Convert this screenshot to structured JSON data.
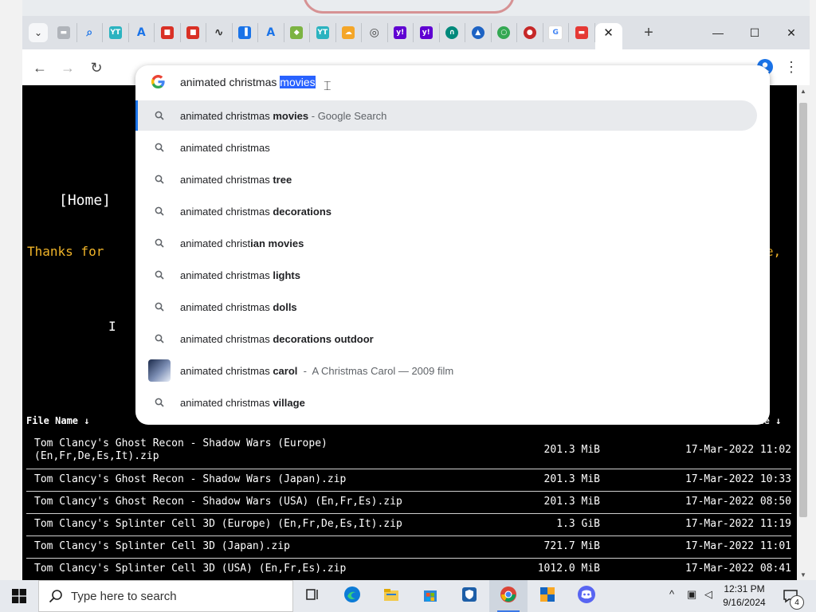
{
  "browser": {
    "tabs": [
      {
        "icon": "document-icon",
        "glyph": "▬",
        "color": "#b0b4ba"
      },
      {
        "icon": "search-icon",
        "glyph": "⌕",
        "color": "#1a73e8"
      },
      {
        "icon": "ytb-icon",
        "glyph": "YT",
        "color": "#2bb3c0"
      },
      {
        "icon": "a-logo-icon",
        "glyph": "A",
        "color": "#1a73e8"
      },
      {
        "icon": "bookmark-red-icon",
        "glyph": "■",
        "color": "#d93025"
      },
      {
        "icon": "bookmark-red-icon",
        "glyph": "■",
        "color": "#d93025"
      },
      {
        "icon": "chart-line-icon",
        "glyph": "∿",
        "color": "#333333"
      },
      {
        "icon": "bar-chart-icon",
        "glyph": "▐",
        "color": "#1a73e8"
      },
      {
        "icon": "a-logo-icon",
        "glyph": "A",
        "color": "#1a73e8"
      },
      {
        "icon": "diamond-icon",
        "glyph": "◆",
        "color": "#7cb342"
      },
      {
        "icon": "ytb-icon",
        "glyph": "YT",
        "color": "#2bb3c0"
      },
      {
        "icon": "cloud-icon",
        "glyph": "☁",
        "color": "#f4a629"
      },
      {
        "icon": "chrome-icon",
        "glyph": "◎",
        "color": "#444444"
      },
      {
        "icon": "yahoo-icon",
        "glyph": "y!",
        "color": "#6001d2"
      },
      {
        "icon": "yahoo-icon",
        "glyph": "y!",
        "color": "#6001d2"
      },
      {
        "icon": "headphones-icon",
        "glyph": "∩",
        "color": "#00897b"
      },
      {
        "icon": "circle-logo-icon",
        "glyph": "▲",
        "color": "#1e63c4"
      },
      {
        "icon": "circle-g-icon",
        "glyph": "○",
        "color": "#34a853"
      },
      {
        "icon": "record-icon",
        "glyph": "●",
        "color": "#c62828"
      },
      {
        "icon": "google-icon",
        "glyph": "G",
        "color": "#ffffff"
      },
      {
        "icon": "red-badge-icon",
        "glyph": "▬",
        "color": "#e53935"
      }
    ],
    "active_tab_close": "✕",
    "new_tab": "+",
    "window_controls": {
      "minimize": "—",
      "maximize": "☐",
      "close": "✕"
    },
    "toolbar": {
      "back": "←",
      "forward": "→",
      "reload": "↻",
      "menu": "⋮"
    }
  },
  "omnibox": {
    "typed": "animated christmas",
    "autocomplete_selected": "movies",
    "suggestions": [
      {
        "prefix": "animated christmas ",
        "bold": "movies",
        "extra": " - Google Search",
        "icon": "search-icon",
        "highlighted": true
      },
      {
        "prefix": "animated christmas",
        "bold": "",
        "extra": "",
        "icon": "search-icon"
      },
      {
        "prefix": "animated christmas ",
        "bold": "tree",
        "extra": "",
        "icon": "search-icon"
      },
      {
        "prefix": "animated christmas ",
        "bold": "decorations",
        "extra": "",
        "icon": "search-icon"
      },
      {
        "prefix": "animated christ",
        "bold": "ian movies",
        "extra": "",
        "icon": "search-icon"
      },
      {
        "prefix": "animated christmas ",
        "bold": "lights",
        "extra": "",
        "icon": "search-icon"
      },
      {
        "prefix": "animated christmas ",
        "bold": "dolls",
        "extra": "",
        "icon": "search-icon"
      },
      {
        "prefix": "animated christmas ",
        "bold": "decorations outdoor",
        "extra": "",
        "icon": "search-icon"
      },
      {
        "prefix": "animated christmas ",
        "bold": "carol",
        "extra": "  -  A Christmas Carol — 2009 film",
        "icon": "movie-thumbnail"
      },
      {
        "prefix": "animated christmas ",
        "bold": "village",
        "extra": "",
        "icon": "search-icon"
      }
    ]
  },
  "page": {
    "nav_left": "[Home]",
    "nav_right": "]",
    "thanks_left": "Thanks for",
    "thanks_right": "ause,",
    "stray_char": "I",
    "columns": {
      "name": "File Name  ↓",
      "date": "Date  ↓"
    },
    "files": [
      {
        "name": "Tom Clancy's Ghost Recon - Shadow Wars (Europe)\n(En,Fr,De,Es,It).zip",
        "size": "201.3 MiB",
        "date": "17-Mar-2022 11:02"
      },
      {
        "name": "Tom Clancy's Ghost Recon - Shadow Wars (Japan).zip",
        "size": "201.3 MiB",
        "date": "17-Mar-2022 10:33"
      },
      {
        "name": "Tom Clancy's Ghost Recon - Shadow Wars (USA) (En,Fr,Es).zip",
        "size": "201.3 MiB",
        "date": "17-Mar-2022 08:50"
      },
      {
        "name": "Tom Clancy's Splinter Cell 3D (Europe) (En,Fr,De,Es,It).zip",
        "size": "1.3 GiB",
        "date": "17-Mar-2022 11:19"
      },
      {
        "name": "Tom Clancy's Splinter Cell 3D (Japan).zip",
        "size": "721.7 MiB",
        "date": "17-Mar-2022 11:01"
      },
      {
        "name": "Tom Clancy's Splinter Cell 3D (USA) (En,Fr,Es).zip",
        "size": "1012.0 MiB",
        "date": "17-Mar-2022 08:41"
      }
    ]
  },
  "taskbar": {
    "search_placeholder": "Type here to search",
    "apps": [
      {
        "icon": "task-view-icon"
      },
      {
        "icon": "edge-icon"
      },
      {
        "icon": "file-explorer-icon"
      },
      {
        "icon": "microsoft-store-icon"
      },
      {
        "icon": "shield-app-icon"
      },
      {
        "icon": "chrome-icon",
        "active": true
      },
      {
        "icon": "security-shield-icon"
      },
      {
        "icon": "discord-icon"
      }
    ],
    "tray": {
      "chevron": "^",
      "time": "12:31 PM",
      "date": "9/16/2024",
      "notifications": "4"
    }
  },
  "colors": {
    "accent": "#1a73e8",
    "selection": "#2962ff",
    "page_bg": "#000000",
    "thanks_text": "#f0b429"
  }
}
